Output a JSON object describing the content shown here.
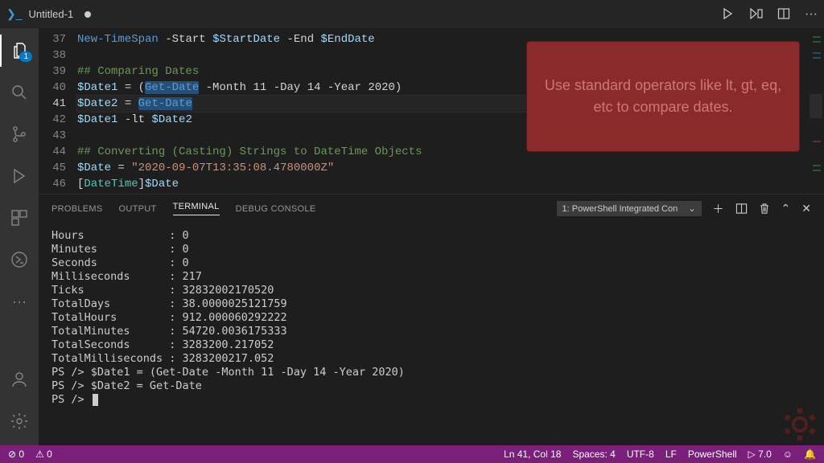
{
  "tab": {
    "title": "Untitled-1"
  },
  "title_actions": {
    "run": "▷",
    "debug": "⎙",
    "split": "▢",
    "more": "···"
  },
  "code": {
    "lines": [
      {
        "n": 37,
        "html": "<span class='tk-cmd'>New-TimeSpan</span> <span class='tk-punc'>-Start</span> <span class='tk-var'>$StartDate</span> <span class='tk-punc'>-End</span> <span class='tk-var'>$EndDate</span>"
      },
      {
        "n": 38,
        "html": ""
      },
      {
        "n": 39,
        "html": "<span class='tk-com'>## Comparing Dates</span>"
      },
      {
        "n": 40,
        "html": "<span class='tk-var'>$Date1</span> = (<span class='tk-cmd sel'>Get-Date</span> <span class='tk-punc'>-Month</span> 11 <span class='tk-punc'>-Day</span> 14 <span class='tk-punc'>-Year</span> 2020)"
      },
      {
        "n": 41,
        "html": "<span class='tk-var'>$Date2</span> = <span class='tk-cmd sel'>Get-Date</span>",
        "current": true
      },
      {
        "n": 42,
        "html": "<span class='tk-var'>$Date1</span> <span class='tk-punc'>-lt</span> <span class='tk-var'>$Date2</span>"
      },
      {
        "n": 43,
        "html": ""
      },
      {
        "n": 44,
        "html": "<span class='tk-com'>## Converting (Casting) Strings to DateTime Objects</span>"
      },
      {
        "n": 45,
        "html": "<span class='tk-var'>$Date</span> = <span class='tk-str'>\"2020-09-07T13:35:08.4780000Z\"</span>"
      },
      {
        "n": 46,
        "html": "[<span class='tk-type'>DateTime</span>]<span class='tk-var'>$Date</span>"
      }
    ]
  },
  "callout": "Use standard operators like lt, gt, eq, etc to compare dates.",
  "panel": {
    "tabs": [
      "PROBLEMS",
      "OUTPUT",
      "TERMINAL",
      "DEBUG CONSOLE"
    ],
    "active_tab": 2,
    "terminal_name": "1: PowerShell Integrated Con"
  },
  "terminal_output": [
    "Hours             : 0",
    "Minutes           : 0",
    "Seconds           : 0",
    "Milliseconds      : 217",
    "Ticks             : 32832002170520",
    "TotalDays         : 38.0000025121759",
    "TotalHours        : 912.000060292222",
    "TotalMinutes      : 54720.0036175333",
    "TotalSeconds      : 3283200.217052",
    "TotalMilliseconds : 3283200217.052",
    "",
    "",
    "PS /> $Date1 = (Get-Date -Month 11 -Day 14 -Year 2020)",
    "PS /> $Date2 = Get-Date",
    "PS /> "
  ],
  "status": {
    "errors": "⊘ 0",
    "warnings": "⚠ 0",
    "ln_col": "Ln 41, Col 18",
    "spaces": "Spaces: 4",
    "encoding": "UTF-8",
    "eol": "LF",
    "language": "PowerShell",
    "ps_ver": "▷ 7.0",
    "bell": "🔔"
  },
  "activity_badge": "1"
}
